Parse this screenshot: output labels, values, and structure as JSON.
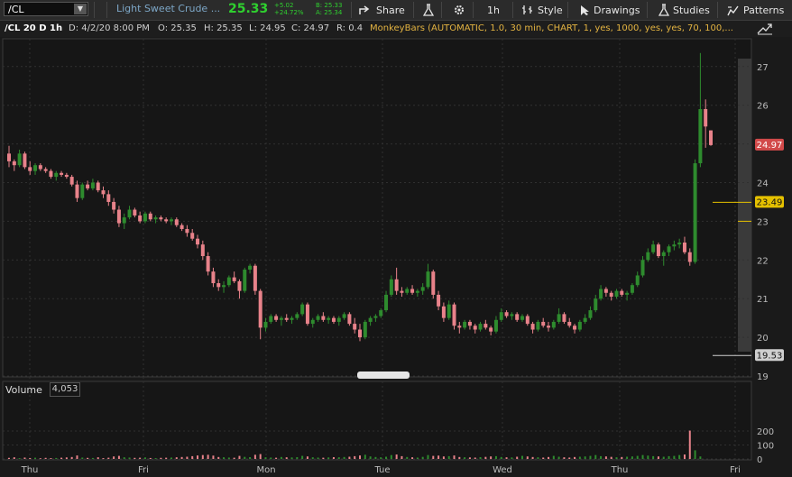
{
  "toolbar": {
    "symbol": "/CL",
    "description": "Light Sweet Crude ...",
    "last": "25.33",
    "change": "+5.02",
    "change_pct": "+24.72%",
    "bid": "B: 25.33",
    "ask": "A: 25.34",
    "share": "Share",
    "timeframe": "1h",
    "style": "Style",
    "drawings": "Drawings",
    "studies": "Studies",
    "patterns": "Patterns"
  },
  "header": {
    "title": "/CL 20 D 1h",
    "date": "D: 4/2/20 8:00 PM",
    "open": "O: 25.35",
    "high": "H: 25.35",
    "low": "L: 24.95",
    "close": "C: 24.97",
    "range": "R: 0.4",
    "study": "MonkeyBars (AUTOMATIC, 1.0, 30 min, CHART, 1, yes, 1000, yes, yes, 70, 100,..."
  },
  "volume": {
    "label": "Volume",
    "value": "4,053"
  },
  "price_tags": {
    "last": "24.97",
    "high_line": "23.49",
    "low_line": "19.53"
  },
  "colors": {
    "up": "#2e8b2e",
    "down": "#e8828a",
    "grid": "#303030",
    "last_tag": "#d24a4a",
    "high_tag": "#e5c100",
    "low_tag": "#cfcfcf"
  },
  "chart_data": {
    "type": "candlestick",
    "interval": "1h",
    "x_ticks": [
      "Thu",
      "Fri",
      "Mon",
      "Tue",
      "Wed",
      "Thu",
      "Fri"
    ],
    "y_ticks": [
      19,
      20,
      21,
      22,
      23,
      24,
      25,
      26,
      27
    ],
    "ylim": [
      19,
      27.5
    ],
    "candles": [
      [
        24.75,
        24.95,
        24.4,
        24.55
      ],
      [
        24.55,
        24.6,
        24.3,
        24.45
      ],
      [
        24.45,
        24.85,
        24.4,
        24.75
      ],
      [
        24.75,
        24.8,
        24.35,
        24.4
      ],
      [
        24.4,
        24.55,
        24.2,
        24.3
      ],
      [
        24.3,
        24.5,
        24.2,
        24.45
      ],
      [
        24.45,
        24.5,
        24.3,
        24.35
      ],
      [
        24.35,
        24.4,
        24.25,
        24.3
      ],
      [
        24.3,
        24.35,
        24.1,
        24.15
      ],
      [
        24.15,
        24.3,
        24.05,
        24.25
      ],
      [
        24.25,
        24.3,
        24.15,
        24.2
      ],
      [
        24.2,
        24.25,
        24.1,
        24.15
      ],
      [
        24.15,
        24.2,
        23.9,
        23.95
      ],
      [
        23.95,
        24.05,
        23.5,
        23.6
      ],
      [
        23.6,
        24.0,
        23.55,
        23.95
      ],
      [
        23.95,
        24.05,
        23.8,
        23.85
      ],
      [
        23.85,
        24.1,
        23.8,
        24.0
      ],
      [
        24.0,
        24.05,
        23.75,
        23.8
      ],
      [
        23.8,
        23.9,
        23.6,
        23.7
      ],
      [
        23.7,
        23.8,
        23.4,
        23.5
      ],
      [
        23.5,
        23.6,
        23.2,
        23.3
      ],
      [
        23.3,
        23.4,
        22.85,
        22.95
      ],
      [
        22.95,
        23.2,
        22.8,
        23.1
      ],
      [
        23.1,
        23.4,
        23.05,
        23.3
      ],
      [
        23.3,
        23.35,
        23.1,
        23.15
      ],
      [
        23.15,
        23.25,
        22.95,
        23.0
      ],
      [
        23.0,
        23.25,
        22.95,
        23.2
      ],
      [
        23.2,
        23.25,
        23.0,
        23.05
      ],
      [
        23.05,
        23.15,
        22.95,
        23.1
      ],
      [
        23.1,
        23.15,
        23.0,
        23.05
      ],
      [
        23.05,
        23.1,
        22.95,
        23.0
      ],
      [
        23.0,
        23.1,
        22.9,
        23.05
      ],
      [
        23.05,
        23.1,
        22.85,
        22.9
      ],
      [
        22.9,
        22.95,
        22.75,
        22.8
      ],
      [
        22.8,
        22.9,
        22.6,
        22.7
      ],
      [
        22.7,
        22.8,
        22.5,
        22.55
      ],
      [
        22.55,
        22.65,
        22.3,
        22.4
      ],
      [
        22.4,
        22.5,
        22.0,
        22.1
      ],
      [
        22.1,
        22.2,
        21.6,
        21.7
      ],
      [
        21.7,
        21.8,
        21.3,
        21.4
      ],
      [
        21.4,
        21.5,
        21.2,
        21.3
      ],
      [
        21.3,
        21.45,
        21.15,
        21.35
      ],
      [
        21.35,
        21.6,
        21.3,
        21.55
      ],
      [
        21.55,
        21.7,
        21.4,
        21.45
      ],
      [
        21.45,
        21.5,
        21.0,
        21.2
      ],
      [
        21.2,
        21.8,
        21.15,
        21.75
      ],
      [
        21.75,
        21.9,
        21.65,
        21.85
      ],
      [
        21.85,
        21.9,
        21.1,
        21.2
      ],
      [
        21.2,
        21.25,
        19.95,
        20.25
      ],
      [
        20.25,
        20.5,
        20.15,
        20.4
      ],
      [
        20.4,
        20.6,
        20.35,
        20.55
      ],
      [
        20.55,
        20.6,
        20.4,
        20.45
      ],
      [
        20.45,
        20.55,
        20.3,
        20.5
      ],
      [
        20.5,
        20.6,
        20.4,
        20.45
      ],
      [
        20.45,
        20.55,
        20.35,
        20.5
      ],
      [
        20.5,
        20.65,
        20.45,
        20.6
      ],
      [
        20.6,
        20.9,
        20.55,
        20.85
      ],
      [
        20.85,
        20.9,
        20.3,
        20.35
      ],
      [
        20.35,
        20.5,
        20.25,
        20.45
      ],
      [
        20.45,
        20.6,
        20.4,
        20.55
      ],
      [
        20.55,
        20.65,
        20.4,
        20.45
      ],
      [
        20.45,
        20.55,
        20.35,
        20.5
      ],
      [
        20.5,
        20.55,
        20.35,
        20.4
      ],
      [
        20.4,
        20.55,
        20.3,
        20.5
      ],
      [
        20.5,
        20.65,
        20.45,
        20.6
      ],
      [
        20.6,
        20.65,
        20.3,
        20.35
      ],
      [
        20.35,
        20.5,
        20.1,
        20.2
      ],
      [
        20.2,
        20.35,
        19.9,
        20.0
      ],
      [
        20.0,
        20.45,
        19.95,
        20.4
      ],
      [
        20.4,
        20.55,
        20.3,
        20.5
      ],
      [
        20.5,
        20.6,
        20.4,
        20.55
      ],
      [
        20.55,
        20.75,
        20.5,
        20.7
      ],
      [
        20.7,
        21.2,
        20.65,
        21.1
      ],
      [
        21.1,
        21.6,
        21.05,
        21.5
      ],
      [
        21.5,
        21.8,
        21.1,
        21.2
      ],
      [
        21.2,
        21.3,
        21.05,
        21.15
      ],
      [
        21.15,
        21.3,
        21.1,
        21.25
      ],
      [
        21.25,
        21.35,
        21.1,
        21.15
      ],
      [
        21.15,
        21.25,
        21.05,
        21.2
      ],
      [
        21.2,
        21.4,
        21.1,
        21.3
      ],
      [
        21.3,
        21.9,
        21.25,
        21.7
      ],
      [
        21.7,
        21.75,
        21.0,
        21.1
      ],
      [
        21.1,
        21.2,
        20.7,
        20.8
      ],
      [
        20.8,
        20.9,
        20.4,
        20.5
      ],
      [
        20.5,
        20.95,
        20.45,
        20.85
      ],
      [
        20.85,
        20.9,
        20.2,
        20.3
      ],
      [
        20.3,
        20.4,
        20.1,
        20.25
      ],
      [
        20.25,
        20.45,
        20.2,
        20.4
      ],
      [
        20.4,
        20.45,
        20.2,
        20.3
      ],
      [
        20.3,
        20.35,
        20.1,
        20.2
      ],
      [
        20.2,
        20.4,
        20.15,
        20.35
      ],
      [
        20.35,
        20.45,
        20.2,
        20.25
      ],
      [
        20.25,
        20.3,
        20.05,
        20.15
      ],
      [
        20.15,
        20.55,
        20.1,
        20.45
      ],
      [
        20.45,
        20.75,
        20.4,
        20.65
      ],
      [
        20.65,
        20.7,
        20.5,
        20.55
      ],
      [
        20.55,
        20.65,
        20.45,
        20.6
      ],
      [
        20.6,
        20.65,
        20.4,
        20.45
      ],
      [
        20.45,
        20.6,
        20.4,
        20.55
      ],
      [
        20.55,
        20.6,
        20.3,
        20.35
      ],
      [
        20.35,
        20.4,
        20.1,
        20.2
      ],
      [
        20.2,
        20.45,
        20.15,
        20.4
      ],
      [
        20.4,
        20.5,
        20.25,
        20.3
      ],
      [
        20.3,
        20.4,
        20.15,
        20.25
      ],
      [
        20.25,
        20.45,
        20.2,
        20.4
      ],
      [
        20.4,
        20.75,
        20.35,
        20.6
      ],
      [
        20.6,
        20.65,
        20.35,
        20.4
      ],
      [
        20.4,
        20.5,
        20.25,
        20.3
      ],
      [
        20.3,
        20.35,
        20.1,
        20.2
      ],
      [
        20.2,
        20.45,
        20.15,
        20.4
      ],
      [
        20.4,
        20.6,
        20.35,
        20.5
      ],
      [
        20.5,
        20.8,
        20.45,
        20.7
      ],
      [
        20.7,
        21.1,
        20.65,
        21.0
      ],
      [
        21.0,
        21.35,
        20.95,
        21.25
      ],
      [
        21.25,
        21.3,
        21.05,
        21.15
      ],
      [
        21.15,
        21.2,
        20.95,
        21.05
      ],
      [
        21.05,
        21.25,
        21.0,
        21.2
      ],
      [
        21.2,
        21.25,
        21.05,
        21.1
      ],
      [
        21.1,
        21.2,
        20.95,
        21.15
      ],
      [
        21.15,
        21.4,
        21.1,
        21.35
      ],
      [
        21.35,
        21.7,
        21.3,
        21.6
      ],
      [
        21.6,
        22.1,
        21.55,
        22.0
      ],
      [
        22.0,
        22.3,
        21.95,
        22.2
      ],
      [
        22.2,
        22.5,
        22.15,
        22.4
      ],
      [
        22.4,
        22.45,
        22.05,
        22.1
      ],
      [
        22.1,
        22.25,
        21.85,
        22.2
      ],
      [
        22.2,
        22.4,
        22.1,
        22.35
      ],
      [
        22.35,
        22.5,
        22.25,
        22.4
      ],
      [
        22.4,
        22.55,
        22.3,
        22.45
      ],
      [
        22.45,
        22.6,
        22.15,
        22.2
      ],
      [
        22.2,
        22.3,
        21.85,
        21.95
      ],
      [
        21.95,
        24.6,
        21.9,
        24.5
      ],
      [
        24.5,
        27.35,
        24.4,
        25.9
      ],
      [
        25.9,
        26.15,
        24.9,
        25.45
      ],
      [
        25.35,
        25.35,
        24.95,
        24.97
      ]
    ],
    "volume": [
      8,
      12,
      6,
      10,
      7,
      9,
      5,
      8,
      6,
      7,
      9,
      11,
      14,
      25,
      10,
      8,
      7,
      12,
      6,
      9,
      18,
      22,
      12,
      10,
      8,
      9,
      11,
      7,
      6,
      8,
      9,
      10,
      12,
      14,
      16,
      20,
      25,
      28,
      30,
      24,
      14,
      12,
      10,
      9,
      22,
      15,
      13,
      30,
      35,
      12,
      10,
      9,
      14,
      12,
      11,
      13,
      22,
      18,
      12,
      10,
      9,
      11,
      13,
      12,
      14,
      16,
      20,
      25,
      30,
      18,
      14,
      12,
      16,
      28,
      32,
      20,
      14,
      12,
      10,
      15,
      28,
      22,
      24,
      18,
      20,
      25,
      14,
      12,
      11,
      10,
      13,
      15,
      18,
      20,
      14,
      12,
      11,
      16,
      22,
      18,
      14,
      12,
      10,
      14,
      22,
      16,
      12,
      10,
      14,
      16,
      18,
      22,
      28,
      20,
      18,
      15,
      12,
      14,
      16,
      18,
      22,
      28,
      24,
      20,
      18,
      16,
      20,
      22,
      28,
      32,
      203,
      62,
      18
    ],
    "volume_ticks": [
      0,
      100,
      200
    ]
  }
}
